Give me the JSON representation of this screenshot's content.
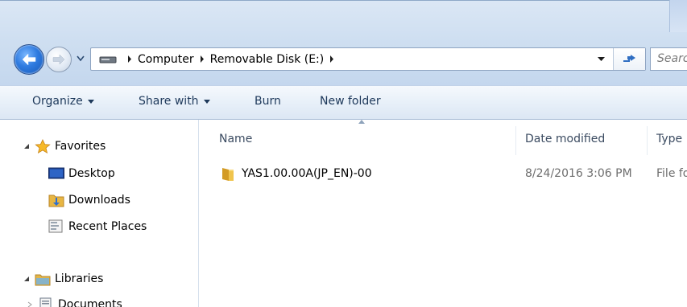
{
  "address": {
    "crumbs": [
      "Computer",
      "Removable Disk (E:)"
    ],
    "search_placeholder": "Search"
  },
  "toolbar": {
    "organize": "Organize",
    "share_with": "Share with",
    "burn": "Burn",
    "new_folder": "New folder"
  },
  "nav": {
    "favorites": "Favorites",
    "desktop": "Desktop",
    "downloads": "Downloads",
    "recent_places": "Recent Places",
    "libraries": "Libraries",
    "documents": "Documents"
  },
  "columns": {
    "name": "Name",
    "date_modified": "Date modified",
    "type": "Type"
  },
  "files": [
    {
      "name": "YAS1.00.00A(JP_EN)-00",
      "date_modified": "8/24/2016 3:06 PM",
      "type": "File folder"
    }
  ],
  "icons": {
    "back": "back-arrow-icon",
    "forward": "forward-arrow-icon",
    "drive": "removable-drive-icon",
    "refresh": "refresh-icon",
    "folder": "folder-icon",
    "star": "star-icon"
  }
}
